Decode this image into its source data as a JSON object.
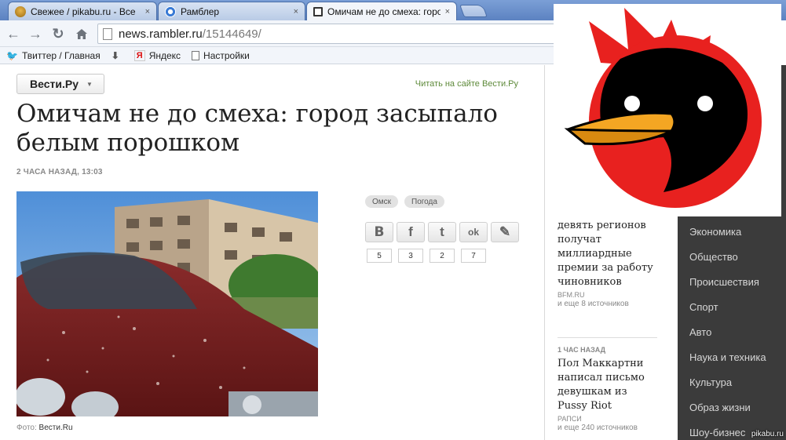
{
  "tabs": [
    {
      "title": "Свежее / pikabu.ru - Все",
      "close": "×"
    },
    {
      "title": "Рамблер",
      "close": "×"
    },
    {
      "title": "Омичам не до смеха: горо",
      "close": "×"
    }
  ],
  "address": {
    "host": "news.rambler.ru",
    "path": "/15144649/"
  },
  "bookmarks": [
    {
      "label": "Твиттер / Главная",
      "icon": "twitter-bird-icon"
    },
    {
      "label": "",
      "icon": "download-arrow-icon"
    },
    {
      "label": "Яндекс",
      "icon": "yandex-icon"
    },
    {
      "label": "Настройки",
      "icon": "page-icon"
    }
  ],
  "article": {
    "source_button": "Вести.Ру",
    "read_link": "Читать на сайте Вести.Ру",
    "headline": "Омичам не до смеха: город засыпало белым порошком",
    "timestamp": "2 ЧАСА НАЗАД, 13:03",
    "caption_label": "Фото:",
    "caption_source": "Вести.Ru",
    "tags": [
      "Омск",
      "Погода"
    ],
    "shares": [
      {
        "icon": "vkontakte-icon",
        "glyph": "B",
        "count": "5"
      },
      {
        "icon": "facebook-icon",
        "glyph": "f",
        "count": "3"
      },
      {
        "icon": "twitter-icon",
        "glyph": "t",
        "count": "2"
      },
      {
        "icon": "odnoklassniki-icon",
        "glyph": "ok",
        "count": "7"
      },
      {
        "icon": "pencil-icon",
        "glyph": "✎",
        "count": ""
      }
    ]
  },
  "news": [
    {
      "time": "",
      "title": "девять регионов получат миллиардные премии за работу чиновников",
      "source": "BFM.RU",
      "more": "и еще 8 источников"
    },
    {
      "time": "1 ЧАС НАЗАД",
      "title": "Пол Маккартни написал письмо девушкам из Pussy Riot",
      "source": "РАПСИ",
      "more": "и еще 240 источников"
    }
  ],
  "rubrics": [
    "Экономика",
    "Общество",
    "Происшествия",
    "Спорт",
    "Авто",
    "Наука и техника",
    "Культура",
    "Образ жизни",
    "Шоу-бизнес"
  ],
  "watermark": "pikabu.ru",
  "colors": {
    "tabstrip": "#5c82c1",
    "rubric_bg": "#3b3b3b",
    "link_green": "#5e8a3a",
    "logo_red": "#e8211f"
  }
}
